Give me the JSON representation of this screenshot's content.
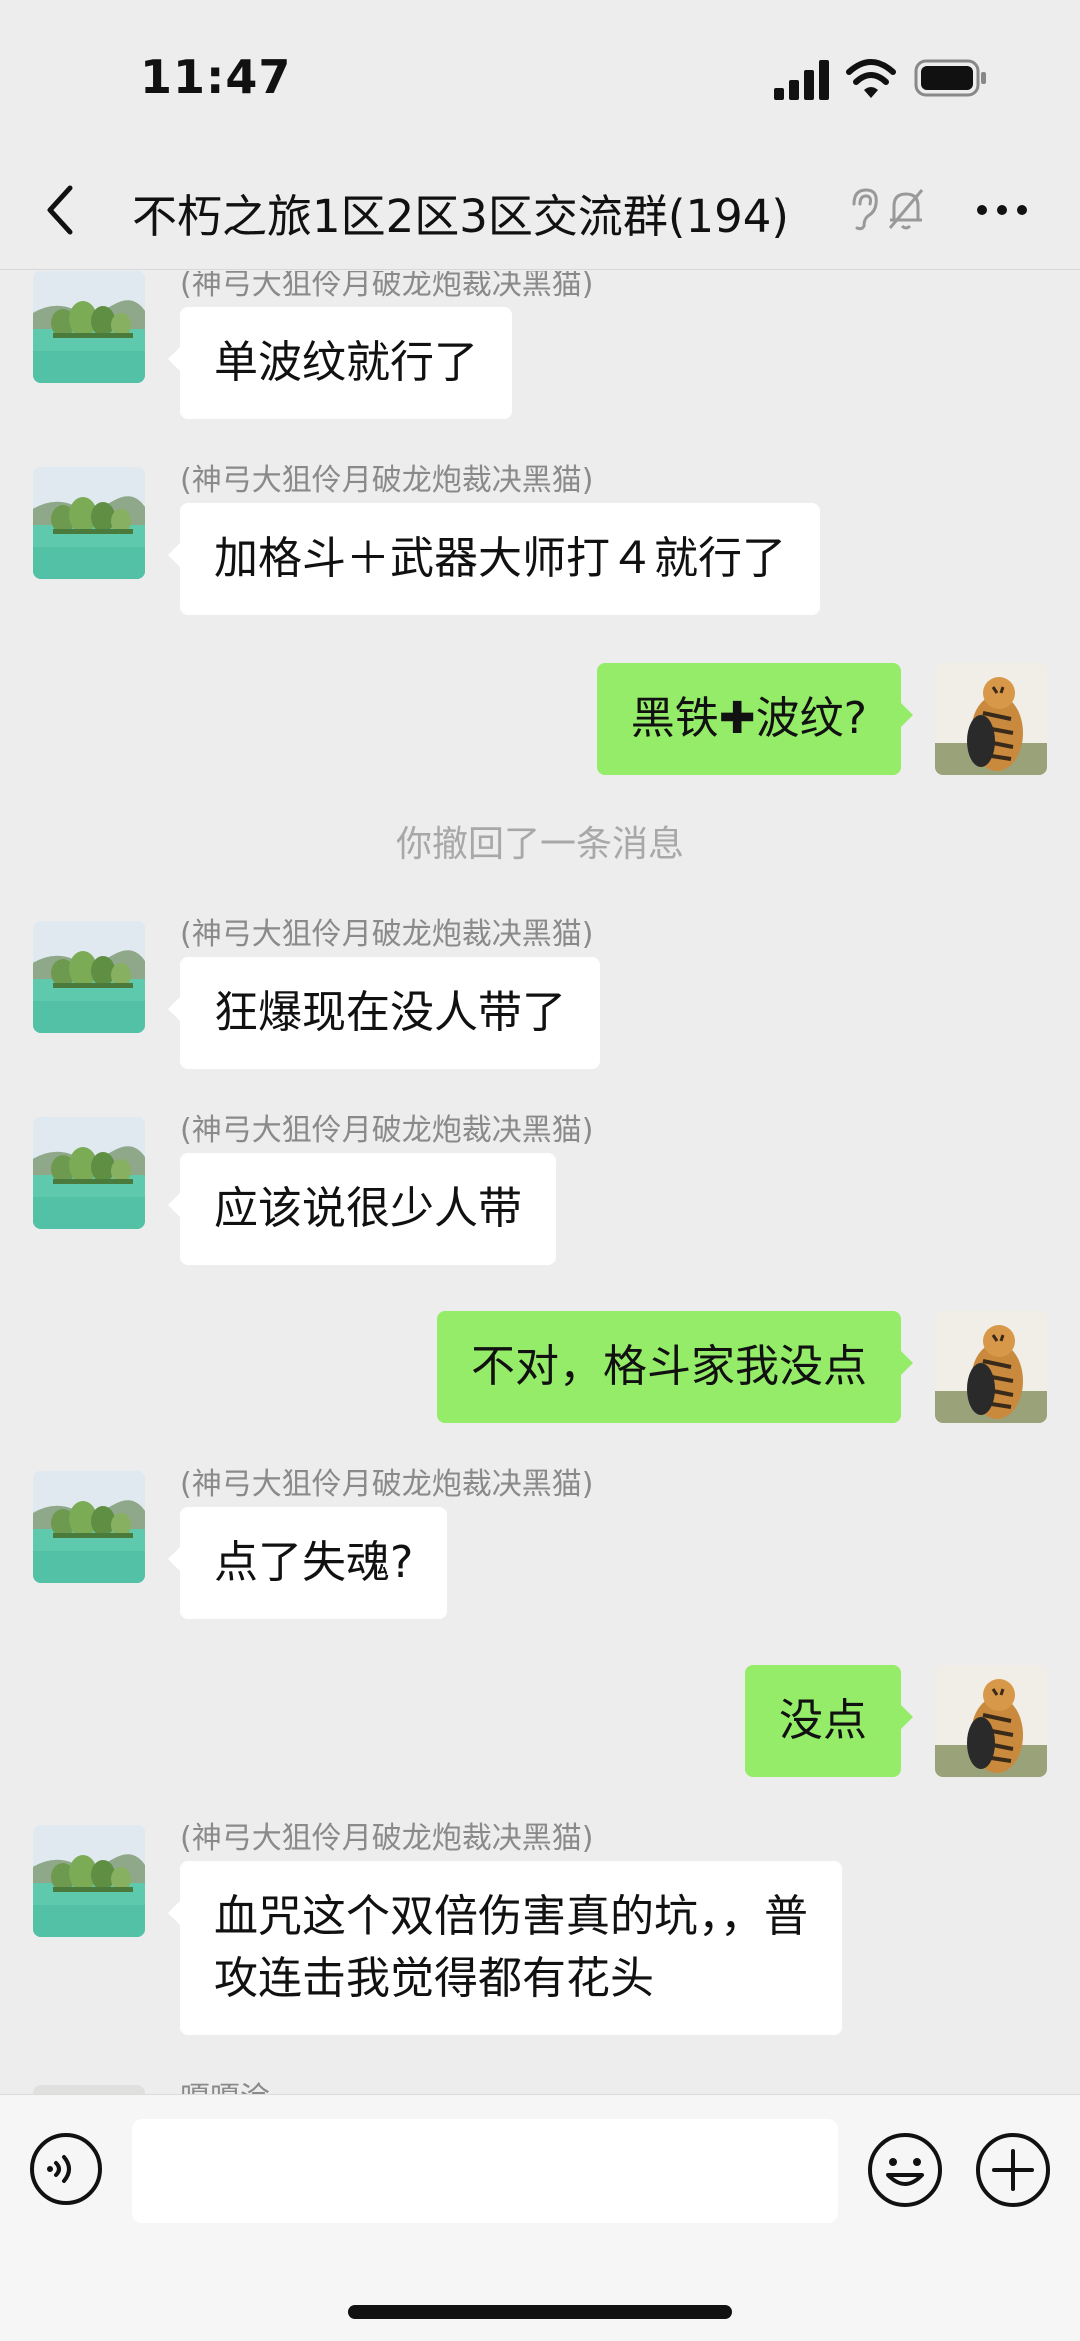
{
  "status_bar": {
    "time": "11:47"
  },
  "header": {
    "title": "不朽之旅1区2区3区交流群(194)"
  },
  "messages": [
    {
      "type": "incoming",
      "sender": "(神弓大狙伶月破龙炮裁决黑猫)",
      "text": "单波纹就行了"
    },
    {
      "type": "incoming",
      "sender": "(神弓大狙伶月破龙炮裁决黑猫)",
      "text": "加格斗＋武器大师打４就行了"
    },
    {
      "type": "outgoing",
      "text": "黑铁✚波纹?"
    },
    {
      "type": "system",
      "text": "你撤回了一条消息"
    },
    {
      "type": "incoming",
      "sender": "(神弓大狙伶月破龙炮裁决黑猫)",
      "text": "狂爆现在没人带了"
    },
    {
      "type": "incoming",
      "sender": "(神弓大狙伶月破龙炮裁决黑猫)",
      "text": "应该说很少人带"
    },
    {
      "type": "outgoing",
      "text": "不对，格斗家我没点"
    },
    {
      "type": "incoming",
      "sender": "(神弓大狙伶月破龙炮裁决黑猫)",
      "text": "点了失魂?"
    },
    {
      "type": "outgoing",
      "text": "没点"
    },
    {
      "type": "incoming",
      "sender": "(神弓大狙伶月破龙炮裁决黑猫)",
      "text_line1": "血咒这个双倍伤害真的坑，，普",
      "text_line2": "攻连击我觉得都有花头"
    },
    {
      "type": "incoming",
      "sender": "嘎嘎涂"
    }
  ],
  "input": {
    "value": ""
  },
  "icons": {
    "back": "chevron-left-icon",
    "ear": "ear-icon",
    "mute": "bell-muted-icon",
    "more": "more-icon",
    "voice": "voice-icon",
    "emoji": "emoji-icon",
    "plus": "plus-icon"
  },
  "colors": {
    "background": "#ededed",
    "outgoing_bubble": "#95ec69",
    "incoming_bubble": "#ffffff"
  }
}
